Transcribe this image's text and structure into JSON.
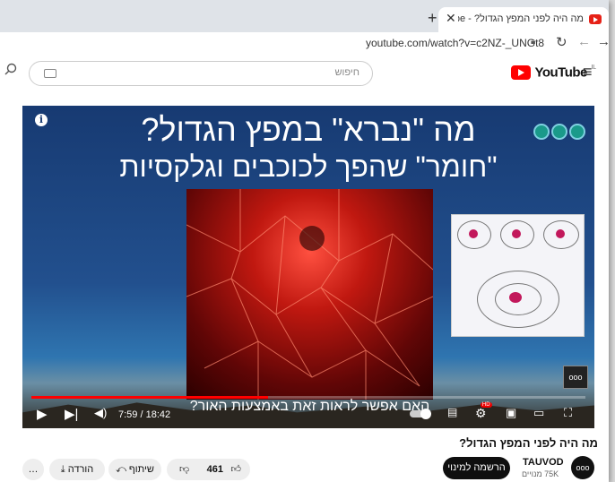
{
  "tab": {
    "title": "מה היה לפני המפץ הגדול? - YouTube",
    "close": "✕"
  },
  "newtab": "+",
  "address": {
    "url": "youtube.com/watch?v=c2NZ-_UNGt8"
  },
  "youtube": {
    "logo": "YouTube",
    "region": "IL",
    "search_placeholder": "חיפוש"
  },
  "video": {
    "title_line1": "מה \"נברא\" במפץ הגדול?",
    "title_line2": "\"חומר\" שהפך לכוכבים וגלקסיות",
    "overlay_text": "האם אפשר לראות זאת באמצעות האור?",
    "time": "7:59 / 18:42",
    "progress": 0.427,
    "settings_badge": "HD"
  },
  "page": {
    "title": "מה היה לפני המפץ הגדול?",
    "channel": "TAUVOD",
    "subscribers": "75K מנויים",
    "subscribe": "הרשמה למינוי",
    "likes": "461",
    "share": "שיתוף",
    "download": "הורדה",
    "more": "…"
  }
}
